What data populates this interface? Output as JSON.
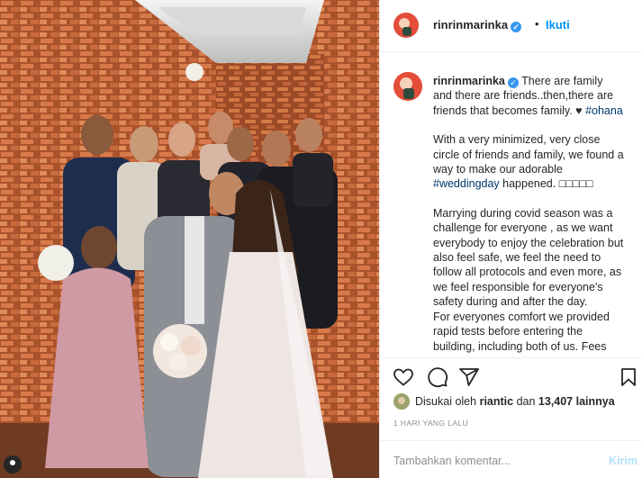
{
  "post": {
    "username": "rinrinmarinka",
    "verified_glyph": "✓",
    "dot": "•",
    "follow_label": "Ikuti"
  },
  "caption": {
    "username": "rinrinmarinka",
    "p1_text": " There are family and there are friends..then,there are friends that becomes family. ♥",
    "p1_tag": "#ohana",
    "p2_text": "With a very minimized, very close circle of friends and family, we found a way to make our adorable ",
    "p2_tag": "#weddingday",
    "p2_end": " happened. □□□□□",
    "p3_text": "Marrying during covid season was a challenge for everyone , as we want everybody to enjoy the celebration but also feel safe, we feel the need to follow all protocols and even more, as we feel responsible for everyone's safety during and after the day.",
    "p3_text2": "For everyones comfort we provided rapid tests before entering the building, including both of us. Fees"
  },
  "icons": {
    "like": "heart-icon",
    "comment": "comment-icon",
    "share": "share-icon",
    "save": "bookmark-icon"
  },
  "likes": {
    "prefix": "Disukai oleh ",
    "user": "riantic",
    "middle": " dan ",
    "count": "13,407 lainnya"
  },
  "timestamp": "1 HARI YANG LALU",
  "comment_box": {
    "placeholder": "Tambahkan komentar...",
    "post_label": "Kirim"
  },
  "colors": {
    "accent": "#0095f6",
    "post_disabled": "#b2dffc",
    "tag": "#00376b",
    "muted": "#8e8e8e"
  }
}
